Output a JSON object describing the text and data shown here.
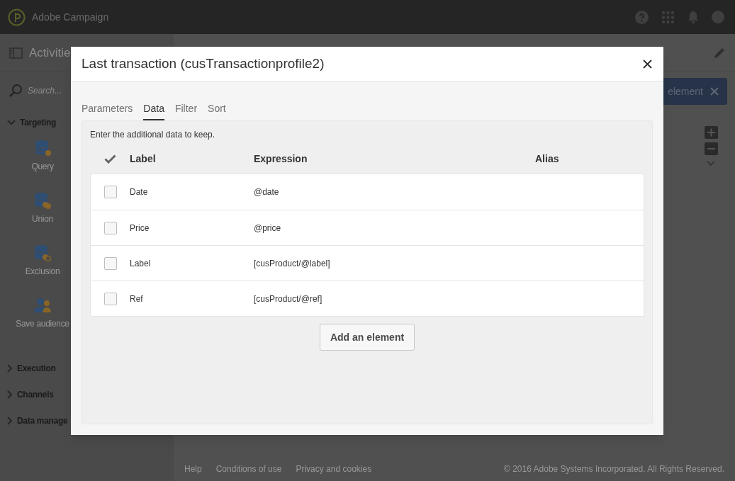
{
  "app": {
    "name": "Adobe Campaign"
  },
  "sidebar": {
    "title": "Activitie",
    "search": {
      "placeholder": "Search..."
    },
    "sections": [
      {
        "label": "Targeting",
        "expanded": true,
        "items": [
          {
            "label": "Query",
            "kind": "query"
          },
          {
            "label": "Union",
            "kind": "union"
          },
          {
            "label": "Exclusion",
            "kind": "exclusion"
          },
          {
            "label": "Save audience",
            "kind": "audience"
          }
        ]
      },
      {
        "label": "Execution",
        "expanded": false
      },
      {
        "label": "Channels",
        "expanded": false
      },
      {
        "label": "Data manage",
        "expanded": false
      }
    ]
  },
  "canvas": {
    "add_button": "element"
  },
  "footer": {
    "links": [
      "Help",
      "Conditions of use",
      "Privacy and cookies"
    ],
    "copyright": "© 2016 Adobe Systems Incorporated. All Rights Reserved."
  },
  "dialog": {
    "title": "Last transaction (cusTransactionprofile2)",
    "tabs": [
      {
        "label": "Parameters",
        "selected": false
      },
      {
        "label": "Data",
        "selected": true
      },
      {
        "label": "Filter",
        "selected": false
      },
      {
        "label": "Sort",
        "selected": false
      }
    ],
    "description": "Enter the additional data to keep.",
    "table": {
      "columns": [
        "Label",
        "Expression",
        "Alias"
      ],
      "rows": [
        {
          "checked": false,
          "label": "Date",
          "expression": "@date"
        },
        {
          "checked": false,
          "label": "Price",
          "expression": "@price"
        },
        {
          "checked": false,
          "label": "Label",
          "expression": "[cusProduct/@label]"
        },
        {
          "checked": false,
          "label": "Ref",
          "expression": "[cusProduct/@ref]"
        }
      ]
    },
    "add_button": "Add an element"
  }
}
